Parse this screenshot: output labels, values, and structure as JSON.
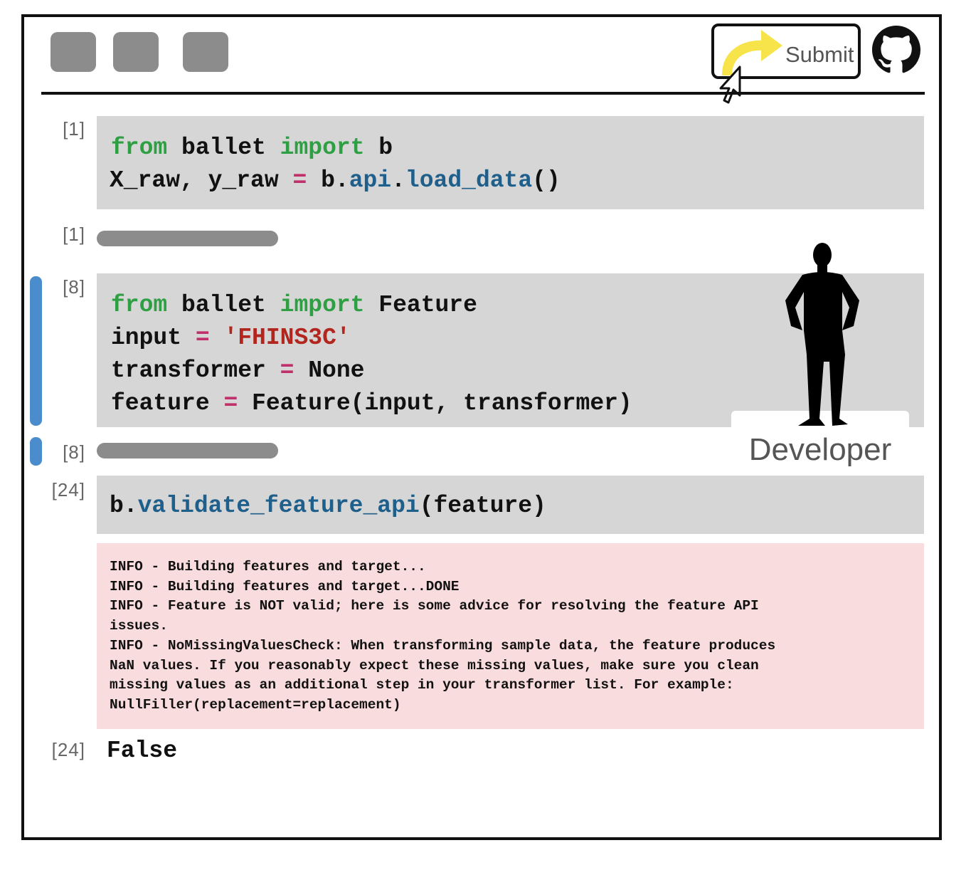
{
  "toolbar": {
    "submit_label": "Submit"
  },
  "icons": [
    "window-button-icon",
    "curved-arrow-icon",
    "mouse-cursor-icon",
    "github-icon",
    "developer-silhouette-icon"
  ],
  "colors": {
    "keyword": "#2ea043",
    "operator": "#c0306a",
    "string": "#b3261e",
    "function": "#1f5f8b",
    "cell_bg": "#d6d6d6",
    "log_bg": "#f9dcde",
    "active_bar": "#4a8ccc",
    "arrow": "#f7e34a"
  },
  "cells": [
    {
      "input_prompt": "[1]",
      "output_prompt": "[1]",
      "line1": {
        "kw1": "from",
        "mod": " ballet ",
        "kw2": "import",
        "name": " b"
      },
      "line2": {
        "lhs": "X_raw, y_raw ",
        "op": "=",
        "obj": " b.",
        "attr1": "api",
        "dot": ".",
        "attr2": "load_data",
        "call": "()"
      }
    },
    {
      "input_prompt": "[8]",
      "output_prompt": "[8]",
      "line1": {
        "kw1": "from",
        "mod": " ballet ",
        "kw2": "import",
        "name": " Feature"
      },
      "line2": {
        "lhs": "input ",
        "op": "=",
        "sp": " ",
        "str": "'FHINS3C'"
      },
      "line3": {
        "lhs": "transformer ",
        "op": "=",
        "rhs": " None"
      },
      "line4": {
        "lhs": "feature ",
        "op": "=",
        "rhs": " Feature(input, transformer)"
      }
    },
    {
      "input_prompt": "[24]",
      "output_prompt": "[24]",
      "line1": {
        "obj": "b.",
        "fn": "validate_feature_api",
        "args": "(feature)"
      },
      "log": [
        "INFO - Building features and target...",
        "INFO - Building features and target...DONE",
        "INFO - Feature is NOT valid; here is some advice for resolving the feature API",
        "issues.",
        "INFO - NoMissingValuesCheck: When transforming sample data, the feature produces",
        "NaN values. If you reasonably expect these missing values, make sure you clean",
        "missing values as an additional step in your transformer list. For example:",
        "NullFiller(replacement=replacement)"
      ],
      "result": "False"
    }
  ],
  "developer": {
    "label": "Developer"
  }
}
